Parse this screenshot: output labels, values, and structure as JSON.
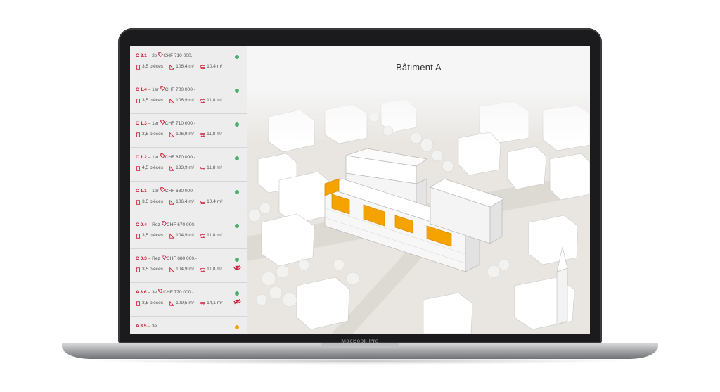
{
  "device": {
    "brand": "MacBook Pro"
  },
  "building": {
    "title": "Bâtiment A"
  },
  "colors": {
    "unit_code": "#c8102e",
    "available": "#4caf6e",
    "reserved": "#f5a300",
    "highlight": "#f5a300"
  },
  "units": [
    {
      "code": "C 2.1",
      "floor": "2e",
      "price": "CHF 710 000.-",
      "rooms": "3,5 pièces",
      "area": "106,4 m²",
      "balcony": "10,4 m²",
      "status": "available"
    },
    {
      "code": "C 1.4",
      "floor": "1er",
      "price": "CHF 700 000.-",
      "rooms": "3,5 pièces",
      "area": "106,9 m²",
      "balcony": "11,8 m²",
      "status": "available"
    },
    {
      "code": "C 1.3",
      "floor": "1er",
      "price": "CHF 710 000.-",
      "rooms": "3,5 pièces",
      "area": "106,9 m²",
      "balcony": "11,8 m²",
      "status": "available"
    },
    {
      "code": "C 1.2",
      "floor": "1er",
      "price": "CHF 870 000.-",
      "rooms": "4,5 pièces",
      "area": "133,9 m²",
      "balcony": "11,8 m²",
      "status": "available"
    },
    {
      "code": "C 1.1",
      "floor": "1er",
      "price": "CHF 680 000.-",
      "rooms": "3,5 pièces",
      "area": "106,4 m²",
      "balcony": "10,4 m²",
      "status": "available"
    },
    {
      "code": "C 0.4",
      "floor": "Rez",
      "price": "CHF 670 000.-",
      "rooms": "3,5 pièces",
      "area": "104,9 m²",
      "balcony": "11,8 m²",
      "status": "available"
    },
    {
      "code": "C 0.3",
      "floor": "Rez",
      "price": "CHF 680 000.-",
      "rooms": "3,5 pièces",
      "area": "104,9 m²",
      "balcony": "11,8 m²",
      "status": "available-viewed"
    },
    {
      "code": "A 3.6",
      "floor": "3e",
      "price": "CHF 770 000.-",
      "rooms": "3,5 pièces",
      "area": "109,5 m²",
      "balcony": "14,1 m²",
      "status": "available-viewed"
    },
    {
      "code": "A 3.5",
      "floor": "3e",
      "price": "",
      "rooms": "",
      "area": "",
      "balcony": "",
      "status": "reserved"
    }
  ],
  "icons": {
    "price": "tag-icon",
    "rooms": "door-icon",
    "area": "ruler-icon",
    "balcony": "balcony-icon",
    "viewed": "eye-icon"
  }
}
